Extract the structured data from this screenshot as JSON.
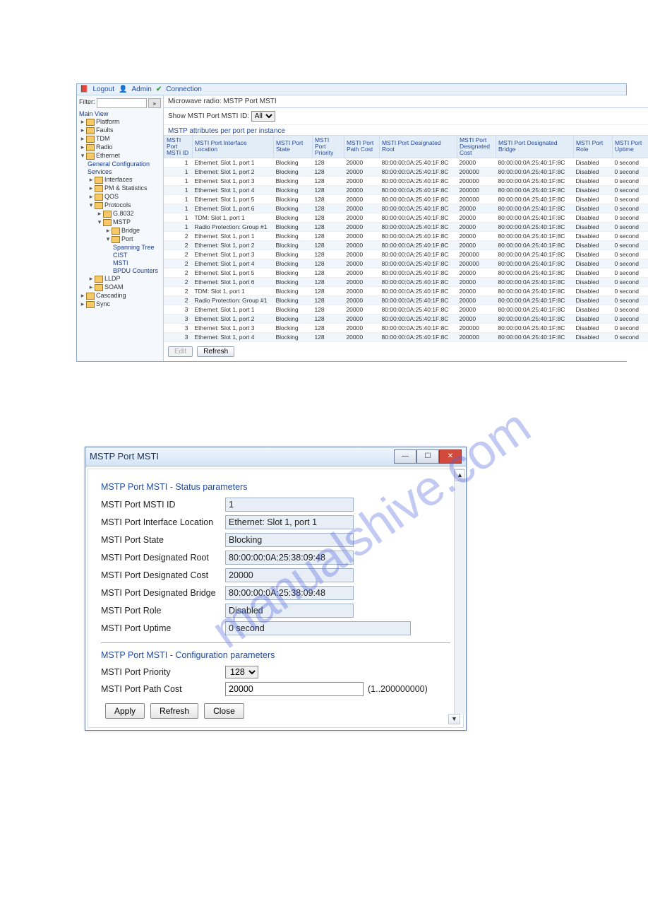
{
  "watermark": "manualshive.com",
  "win1": {
    "topbar": {
      "logout": "Logout",
      "admin": "Admin",
      "connection": "Connection"
    },
    "filter_label": "Filter:",
    "breadcrumb": "Microwave radio: MSTP Port MSTI",
    "show_label": "Show MSTI Port MSTI ID:",
    "show_value": "All",
    "section_title": "MSTP attributes per port per instance",
    "btn_edit": "Edit",
    "btn_refresh": "Refresh",
    "nav": {
      "main_view": "Main View",
      "platform": "Platform",
      "faults": "Faults",
      "tdm": "TDM",
      "radio": "Radio",
      "ethernet": "Ethernet",
      "gen_conf": "General Configuration",
      "services": "Services",
      "interfaces": "Interfaces",
      "pm_stats": "PM & Statistics",
      "qos": "QOS",
      "protocols": "Protocols",
      "g8032": "G.8032",
      "mstp": "MSTP",
      "bridge": "Bridge",
      "port": "Port",
      "spanning_tree": "Spanning Tree",
      "cist": "CIST",
      "msti": "MSTI",
      "bpdu": "BPDU Counters",
      "lldp": "LLDP",
      "soam": "SOAM",
      "cascading": "Cascading",
      "sync": "Sync"
    },
    "cols": {
      "c0": "MSTI Port MSTI ID",
      "c1": "MSTI Port Interface Location",
      "c2": "MSTI Port State",
      "c3": "MSTI Port Priority",
      "c4": "MSTI Port Path Cost",
      "c5": "MSTI Port Designated Root",
      "c6": "MSTI Port Designated Cost",
      "c7": "MSTI Port Designated Bridge",
      "c8": "MSTI Port Role",
      "c9": "MSTI Port Uptime"
    },
    "rows": [
      {
        "id": "1",
        "loc": "Ethernet: Slot 1, port 1",
        "state": "Blocking",
        "prio": "128",
        "cost": "20000",
        "root": "80:00:00:0A:25:40:1F:8C",
        "dcost": "20000",
        "bridge": "80:00:00:0A:25:40:1F:8C",
        "role": "Disabled",
        "up": "0 second"
      },
      {
        "id": "1",
        "loc": "Ethernet: Slot 1, port 2",
        "state": "Blocking",
        "prio": "128",
        "cost": "20000",
        "root": "80:00:00:0A:25:40:1F:8C",
        "dcost": "200000",
        "bridge": "80:00:00:0A:25:40:1F:8C",
        "role": "Disabled",
        "up": "0 second"
      },
      {
        "id": "1",
        "loc": "Ethernet: Slot 1, port 3",
        "state": "Blocking",
        "prio": "128",
        "cost": "20000",
        "root": "80:00:00:0A:25:40:1F:8C",
        "dcost": "200000",
        "bridge": "80:00:00:0A:25:40:1F:8C",
        "role": "Disabled",
        "up": "0 second"
      },
      {
        "id": "1",
        "loc": "Ethernet: Slot 1, port 4",
        "state": "Blocking",
        "prio": "128",
        "cost": "20000",
        "root": "80:00:00:0A:25:40:1F:8C",
        "dcost": "200000",
        "bridge": "80:00:00:0A:25:40:1F:8C",
        "role": "Disabled",
        "up": "0 second"
      },
      {
        "id": "1",
        "loc": "Ethernet: Slot 1, port 5",
        "state": "Blocking",
        "prio": "128",
        "cost": "20000",
        "root": "80:00:00:0A:25:40:1F:8C",
        "dcost": "200000",
        "bridge": "80:00:00:0A:25:40:1F:8C",
        "role": "Disabled",
        "up": "0 second"
      },
      {
        "id": "1",
        "loc": "Ethernet: Slot 1, port 6",
        "state": "Blocking",
        "prio": "128",
        "cost": "20000",
        "root": "80:00:00:0A:25:40:1F:8C",
        "dcost": "20000",
        "bridge": "80:00:00:0A:25:40:1F:8C",
        "role": "Disabled",
        "up": "0 second"
      },
      {
        "id": "1",
        "loc": "TDM: Slot 1, port 1",
        "state": "Blocking",
        "prio": "128",
        "cost": "20000",
        "root": "80:00:00:0A:25:40:1F:8C",
        "dcost": "20000",
        "bridge": "80:00:00:0A:25:40:1F:8C",
        "role": "Disabled",
        "up": "0 second"
      },
      {
        "id": "1",
        "loc": "Radio Protection: Group #1",
        "state": "Blocking",
        "prio": "128",
        "cost": "20000",
        "root": "80:00:00:0A:25:40:1F:8C",
        "dcost": "20000",
        "bridge": "80:00:00:0A:25:40:1F:8C",
        "role": "Disabled",
        "up": "0 second"
      },
      {
        "id": "2",
        "loc": "Ethernet: Slot 1, port 1",
        "state": "Blocking",
        "prio": "128",
        "cost": "20000",
        "root": "80:00:00:0A:25:40:1F:8C",
        "dcost": "20000",
        "bridge": "80:00:00:0A:25:40:1F:8C",
        "role": "Disabled",
        "up": "0 second"
      },
      {
        "id": "2",
        "loc": "Ethernet: Slot 1, port 2",
        "state": "Blocking",
        "prio": "128",
        "cost": "20000",
        "root": "80:00:00:0A:25:40:1F:8C",
        "dcost": "20000",
        "bridge": "80:00:00:0A:25:40:1F:8C",
        "role": "Disabled",
        "up": "0 second"
      },
      {
        "id": "2",
        "loc": "Ethernet: Slot 1, port 3",
        "state": "Blocking",
        "prio": "128",
        "cost": "20000",
        "root": "80:00:00:0A:25:40:1F:8C",
        "dcost": "200000",
        "bridge": "80:00:00:0A:25:40:1F:8C",
        "role": "Disabled",
        "up": "0 second"
      },
      {
        "id": "2",
        "loc": "Ethernet: Slot 1, port 4",
        "state": "Blocking",
        "prio": "128",
        "cost": "20000",
        "root": "80:00:00:0A:25:40:1F:8C",
        "dcost": "200000",
        "bridge": "80:00:00:0A:25:40:1F:8C",
        "role": "Disabled",
        "up": "0 second"
      },
      {
        "id": "2",
        "loc": "Ethernet: Slot 1, port 5",
        "state": "Blocking",
        "prio": "128",
        "cost": "20000",
        "root": "80:00:00:0A:25:40:1F:8C",
        "dcost": "20000",
        "bridge": "80:00:00:0A:25:40:1F:8C",
        "role": "Disabled",
        "up": "0 second"
      },
      {
        "id": "2",
        "loc": "Ethernet: Slot 1, port 6",
        "state": "Blocking",
        "prio": "128",
        "cost": "20000",
        "root": "80:00:00:0A:25:40:1F:8C",
        "dcost": "20000",
        "bridge": "80:00:00:0A:25:40:1F:8C",
        "role": "Disabled",
        "up": "0 second"
      },
      {
        "id": "2",
        "loc": "TDM: Slot 1, port 1",
        "state": "Blocking",
        "prio": "128",
        "cost": "20000",
        "root": "80:00:00:0A:25:40:1F:8C",
        "dcost": "20000",
        "bridge": "80:00:00:0A:25:40:1F:8C",
        "role": "Disabled",
        "up": "0 second"
      },
      {
        "id": "2",
        "loc": "Radio Protection: Group #1",
        "state": "Blocking",
        "prio": "128",
        "cost": "20000",
        "root": "80:00:00:0A:25:40:1F:8C",
        "dcost": "20000",
        "bridge": "80:00:00:0A:25:40:1F:8C",
        "role": "Disabled",
        "up": "0 second"
      },
      {
        "id": "3",
        "loc": "Ethernet: Slot 1, port 1",
        "state": "Blocking",
        "prio": "128",
        "cost": "20000",
        "root": "80:00:00:0A:25:40:1F:8C",
        "dcost": "20000",
        "bridge": "80:00:00:0A:25:40:1F:8C",
        "role": "Disabled",
        "up": "0 second"
      },
      {
        "id": "3",
        "loc": "Ethernet: Slot 1, port 2",
        "state": "Blocking",
        "prio": "128",
        "cost": "20000",
        "root": "80:00:00:0A:25:40:1F:8C",
        "dcost": "20000",
        "bridge": "80:00:00:0A:25:40:1F:8C",
        "role": "Disabled",
        "up": "0 second"
      },
      {
        "id": "3",
        "loc": "Ethernet: Slot 1, port 3",
        "state": "Blocking",
        "prio": "128",
        "cost": "20000",
        "root": "80:00:00:0A:25:40:1F:8C",
        "dcost": "200000",
        "bridge": "80:00:00:0A:25:40:1F:8C",
        "role": "Disabled",
        "up": "0 second"
      },
      {
        "id": "3",
        "loc": "Ethernet: Slot 1, port 4",
        "state": "Blocking",
        "prio": "128",
        "cost": "20000",
        "root": "80:00:00:0A:25:40:1F:8C",
        "dcost": "200000",
        "bridge": "80:00:00:0A:25:40:1F:8C",
        "role": "Disabled",
        "up": "0 second"
      }
    ]
  },
  "dlg": {
    "title": "MSTP Port MSTI",
    "sect_status": "MSTP Port MSTI - Status parameters",
    "sect_config": "MSTP Port MSTI - Configuration parameters",
    "labs": {
      "id": "MSTI Port MSTI ID",
      "loc": "MSTI Port Interface Location",
      "state": "MSTI Port State",
      "root": "MSTI Port Designated Root",
      "cost": "MSTI Port Designated Cost",
      "bridge": "MSTI Port Designated Bridge",
      "role": "MSTI Port Role",
      "up": "MSTI Port Uptime",
      "prio": "MSTI Port Priority",
      "path": "MSTI Port Path Cost"
    },
    "vals": {
      "id": "1",
      "loc": "Ethernet: Slot 1, port 1",
      "state": "Blocking",
      "root": "80:00:00:0A:25:38:09:48",
      "cost": "20000",
      "bridge": "80:00:00:0A:25:38:09:48",
      "role": "Disabled",
      "up": "0 second",
      "prio": "128",
      "path": "20000"
    },
    "hint": "(1..200000000)",
    "btn_apply": "Apply",
    "btn_refresh": "Refresh",
    "btn_close": "Close"
  }
}
